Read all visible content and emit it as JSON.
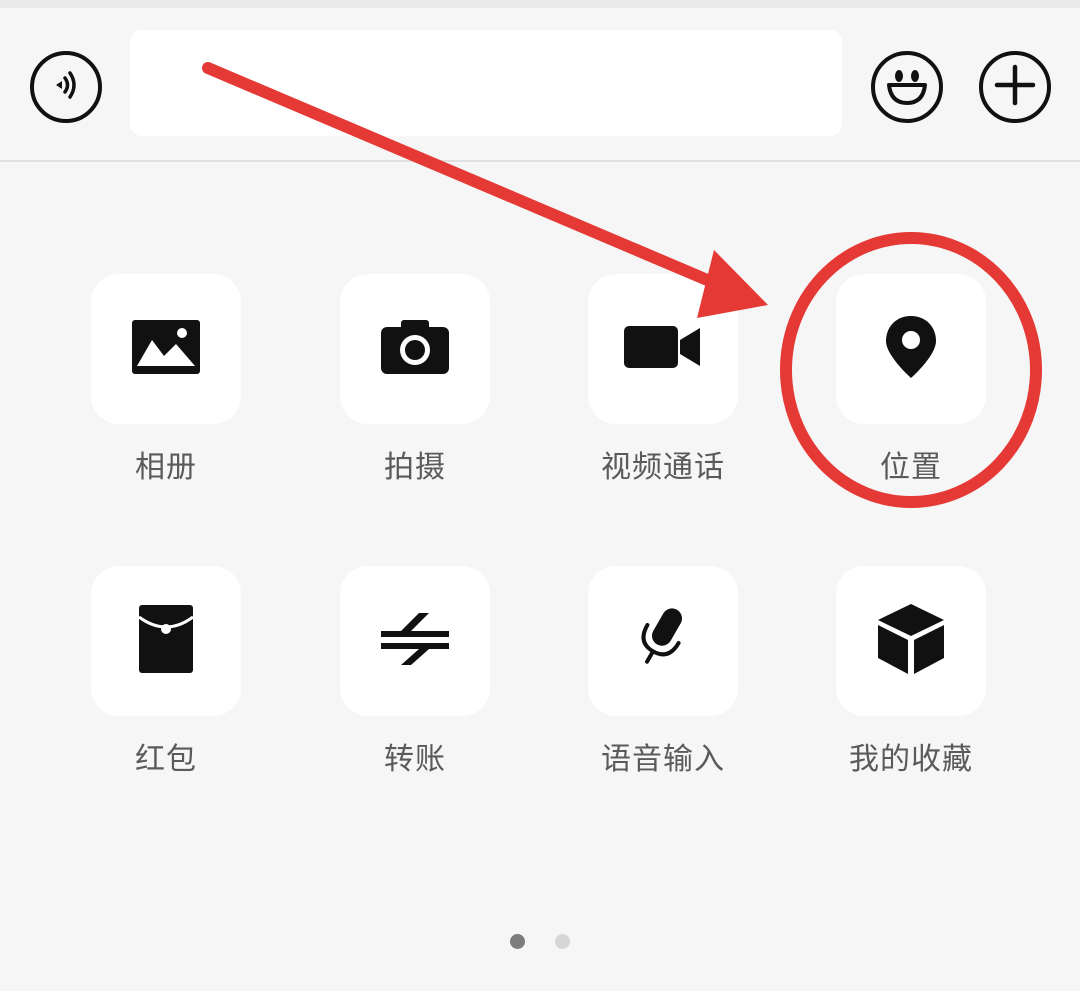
{
  "input_bar": {
    "text_value": "",
    "left_icon": "voice-icon",
    "right_icons": [
      "emoji-icon",
      "plus-icon"
    ]
  },
  "tiles": [
    {
      "label": "相册",
      "icon": "album-icon"
    },
    {
      "label": "拍摄",
      "icon": "camera-icon"
    },
    {
      "label": "视频通话",
      "icon": "video-call-icon"
    },
    {
      "label": "位置",
      "icon": "location-pin-icon"
    },
    {
      "label": "红包",
      "icon": "red-packet-icon"
    },
    {
      "label": "转账",
      "icon": "transfer-icon"
    },
    {
      "label": "语音输入",
      "icon": "microphone-icon"
    },
    {
      "label": "我的收藏",
      "icon": "favorites-cube-icon"
    }
  ],
  "pagination": {
    "current_page": 1,
    "total_pages": 2
  },
  "annotation": {
    "color": "#e53935",
    "highlighted_item": "位置"
  }
}
